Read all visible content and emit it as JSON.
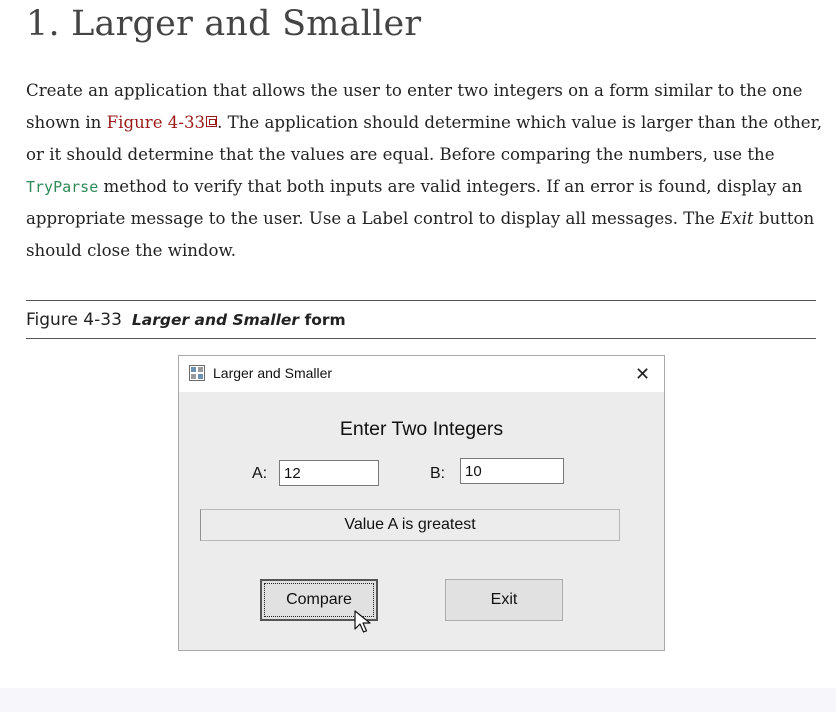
{
  "title": "1. Larger and Smaller",
  "paragraph": {
    "p1": "Create an application that allows the user to enter two integers on a form similar to the one shown in ",
    "figure_link": "Figure 4-33",
    "p2": ". The application should determine which value is larger than the other, or it should determine that the values are equal. Before comparing the numbers, use the ",
    "code": "TryParse",
    "p3": " method to verify that both inputs are valid integers. If an error is found, display an appropriate message to the user. Use a Label control to display all messages. The ",
    "exit_word": "Exit",
    "p4": " button should close the window."
  },
  "figure": {
    "number": "Figure 4-33",
    "name": "Larger and Smaller",
    "suffix": " form"
  },
  "window": {
    "title": "Larger and Smaller",
    "close_glyph": "✕",
    "heading": "Enter Two Integers",
    "label_a": "A:",
    "value_a": "12",
    "label_b": "B:",
    "value_b": "10",
    "message": "Value A is greatest",
    "compare_label": "Compare",
    "exit_label": "Exit"
  },
  "icons": {
    "window_icon": "form-icon",
    "close": "close-icon",
    "cursor": "mouse-pointer-icon",
    "external": "external-link-icon"
  }
}
